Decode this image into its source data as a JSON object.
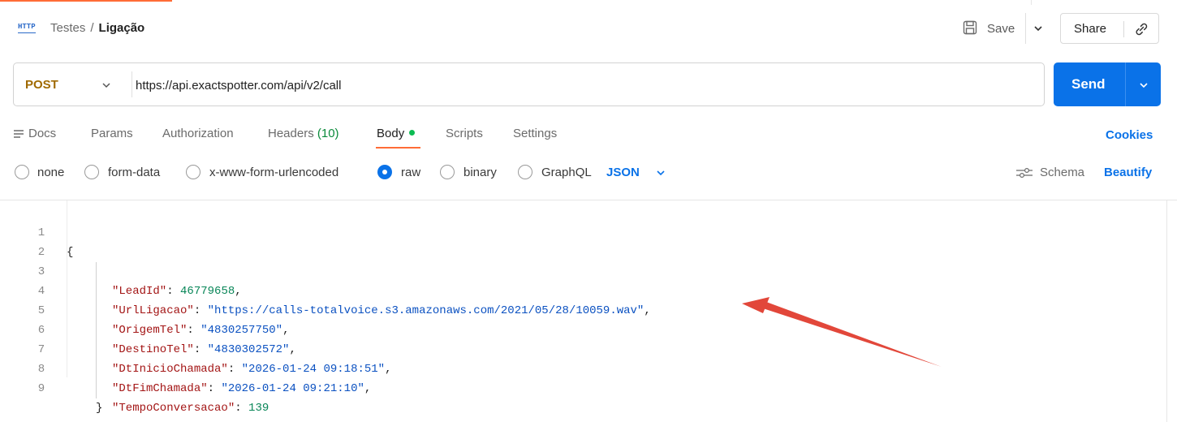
{
  "header": {
    "http_badge": "HTTP",
    "breadcrumb_parent": "Testes",
    "breadcrumb_sep": "/",
    "breadcrumb_current": "Ligação",
    "save_label": "Save",
    "share_label": "Share"
  },
  "request": {
    "method": "POST",
    "url": "https://api.exactspotter.com/api/v2/call",
    "send_label": "Send"
  },
  "tabs": {
    "docs": "Docs",
    "params": "Params",
    "authorization": "Authorization",
    "headers": "Headers",
    "headers_count": "(10)",
    "body": "Body",
    "scripts": "Scripts",
    "settings": "Settings",
    "active": "Body"
  },
  "cookies_label": "Cookies",
  "body_types": {
    "none": "none",
    "form_data": "form-data",
    "urlencoded": "x-www-form-urlencoded",
    "raw": "raw",
    "binary": "binary",
    "graphql": "GraphQL",
    "selected": "raw",
    "format": "JSON",
    "schema_label": "Schema",
    "beautify_label": "Beautify"
  },
  "editor": {
    "line_numbers": [
      "1",
      "2",
      "3",
      "4",
      "5",
      "6",
      "7",
      "8",
      "9"
    ],
    "open_brace": "{",
    "close_brace": "}",
    "fields": [
      {
        "key": "\"LeadId\"",
        "value": "46779658",
        "kind": "number",
        "comma": ","
      },
      {
        "key": "\"UrlLigacao\"",
        "value": "\"https://calls-totalvoice.s3.amazonaws.com/2021/05/28/10059.wav\"",
        "kind": "string",
        "comma": ","
      },
      {
        "key": "\"OrigemTel\"",
        "value": "\"4830257750\"",
        "kind": "string",
        "comma": ","
      },
      {
        "key": "\"DestinoTel\"",
        "value": "\"4830302572\"",
        "kind": "string",
        "comma": ","
      },
      {
        "key": "\"DtInicioChamada\"",
        "value": "\"2026-01-24 09:18:51\"",
        "kind": "string",
        "comma": ","
      },
      {
        "key": "\"DtFimChamada\"",
        "value": "\"2026-01-24 09:21:10\"",
        "kind": "string",
        "comma": ","
      },
      {
        "key": "\"TempoConversacao\"",
        "value": "139",
        "kind": "number",
        "comma": ""
      }
    ]
  },
  "colors": {
    "accent_orange": "#ff6c37",
    "send_blue": "#0a72e8",
    "method_post": "#a06a00",
    "json_key": "#a31515",
    "json_string": "#0b51c1",
    "json_number": "#098658",
    "annotation_arrow": "#e2473a"
  }
}
